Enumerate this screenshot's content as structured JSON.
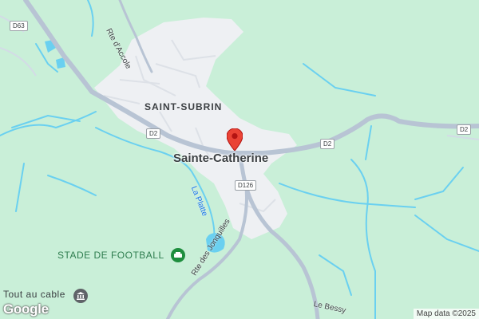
{
  "map": {
    "places": {
      "town": "Sainte-Catherine",
      "district": "SAINT-SUBRIN"
    },
    "roads": {
      "d63": "D63",
      "d2_west": "D2",
      "d2_center": "D2",
      "d2_east": "D2",
      "d126": "D126",
      "rte_accole": "Rte d'Accole",
      "rte_jonquilles": "Rte des Jonquilles",
      "le_bessy": "Le Bessy"
    },
    "water": {
      "la_platte": "La Platte"
    },
    "pois": {
      "stadium": "STADE DE FOOTBALL",
      "cable": "Tout au cable"
    },
    "branding": {
      "logo": "Google",
      "attribution": "Map data ©2025"
    },
    "colors": {
      "background": "#c9efd8",
      "urban": "#eef0f3",
      "road": "#b8c4d4",
      "water": "#6ad0f0",
      "pin": "#ea4335"
    },
    "icons": {
      "pin": "location-pin-icon",
      "stadium": "stadium-icon",
      "cable": "landmark-icon"
    }
  }
}
